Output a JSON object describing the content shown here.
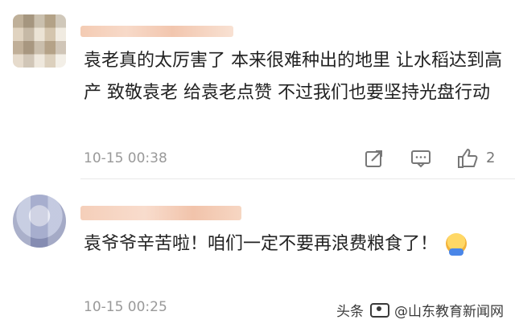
{
  "comments": [
    {
      "text": "袁老真的太厉害了 本来很难种出的地里 让水稻达到高产 致敬袁老 给袁老点赞 不过我们也要坚持光盘行动",
      "time": "10-15 00:38",
      "like_count": "2",
      "icons": [
        "share-icon",
        "reply-icon",
        "thumb-up-icon"
      ]
    },
    {
      "text": "袁爷爷辛苦啦！咱们一定不要再浪费粮食了！",
      "time": "10-15 00:25",
      "emoji": "hugging-emoji"
    }
  ],
  "watermark": {
    "prefix": "头条",
    "handle": "@山东教育新闻网"
  }
}
